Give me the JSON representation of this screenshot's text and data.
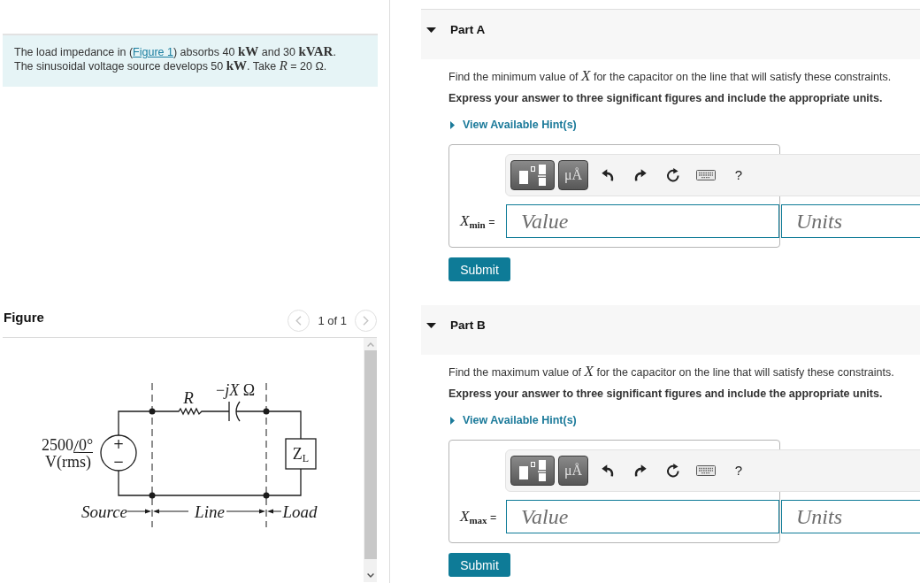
{
  "problem": {
    "statement": [
      [
        {
          "kind": "text",
          "text": "The load impedance in ("
        },
        {
          "kind": "link",
          "text": "Figure 1"
        },
        {
          "kind": "text",
          "text": ") absorbs 40 **kW** and 30 **kVAR**."
        }
      ],
      [
        {
          "kind": "text",
          "text": "The sinusoidal voltage source develops 50 **kW**. Take *R* = 20 Ω."
        }
      ]
    ]
  },
  "figure": {
    "title": "Figure",
    "pager": {
      "label": "1 of 1",
      "prev": {
        "disabled": true
      },
      "next": {
        "disabled": true
      }
    },
    "circuit": {
      "resistor": "R",
      "capacitor": "−*jX* Ω",
      "source_magnitude": "2500",
      "source_phase": "0°",
      "source_unit": "V(rms)",
      "plus_sign": "+",
      "minus_sign": "−",
      "load": "Z$_{L}$",
      "regions": [
        "Source",
        "Line",
        "Load"
      ]
    }
  },
  "parts": [
    {
      "title": "Part A",
      "expanded": true,
      "question": "Find the minimum value of *X* for the capacitor on the line that will satisfy these constraints.",
      "instruction": "Express your answer to three significant figures and include the appropriate units.",
      "hint": "View Available Hint(s)",
      "hints_expanded": false,
      "units_button": "μÅ",
      "help_button": "?",
      "answer_label": "*X*$_{min}$ =",
      "value_placeholder": "Value",
      "units_placeholder": "Units",
      "submit": "Submit"
    },
    {
      "title": "Part B",
      "expanded": true,
      "question": "Find the maximum value of *X* for the capacitor on the line that will satisfy these constraints.",
      "instruction": "Express your answer to three significant figures and include the appropriate units.",
      "hint": "View Available Hint(s)",
      "hints_expanded": false,
      "units_button": "μÅ",
      "help_button": "?",
      "answer_label": "*X*$_{max}$ =",
      "value_placeholder": "Value",
      "units_placeholder": "Units",
      "submit": "Submit"
    }
  ]
}
